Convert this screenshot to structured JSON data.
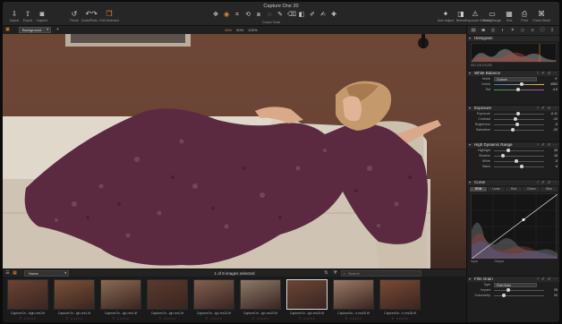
{
  "app": {
    "title": "Capture One 20"
  },
  "toolbar": {
    "left": [
      {
        "label": "Import",
        "icon": "import-icon"
      },
      {
        "label": "Export",
        "icon": "export-icon"
      },
      {
        "label": "Capture",
        "icon": "camera-icon"
      },
      {
        "label": "Reset",
        "icon": "reset-icon"
      },
      {
        "label": "Undo/Redo",
        "icon": "undo-icon"
      },
      {
        "label": "Edit Selected",
        "icon": "edit-selected-icon"
      }
    ],
    "cursor_tools_label": "Cursor Tools",
    "right": [
      {
        "label": "Auto Adjust",
        "icon": "auto-adjust-icon"
      },
      {
        "label": "Before",
        "icon": "before-icon"
      },
      {
        "label": "Exposure Warning",
        "icon": "exposure-warning-icon"
      },
      {
        "label": "Proof Margin",
        "icon": "proof-margin-icon"
      },
      {
        "label": "Grid",
        "icon": "grid-icon"
      },
      {
        "label": "Print",
        "icon": "print-icon"
      },
      {
        "label": "Cheat Sheet",
        "icon": "cheat-sheet-icon"
      }
    ]
  },
  "viewer": {
    "layer": "Background",
    "zoom_levels": [
      "25%",
      "50%",
      "100%"
    ],
    "colors": {
      "backdrop": "#6d4636",
      "sofa": "#d9d0c2",
      "dress": "#5b2a41",
      "hair": "#c49a6c"
    }
  },
  "filmstrip": {
    "album": "Home",
    "selection_status": "1 of 9 images selected",
    "search_placeholder": "Search",
    "thumbs": [
      {
        "name": "CaptureOn...high-res0.tif",
        "selected": false,
        "tone": "#6a4434"
      },
      {
        "name": "CaptureOn...igh-res1.tif",
        "selected": false,
        "tone": "#7a5238"
      },
      {
        "name": "CaptureOn...igh-res1.tif",
        "selected": false,
        "tone": "#8a6a55"
      },
      {
        "name": "CaptureOn...igh-res2.tif",
        "selected": false,
        "tone": "#5a3a2d"
      },
      {
        "name": "CaptureOn...igh-res22.tif",
        "selected": false,
        "tone": "#806050"
      },
      {
        "name": "CaptureOn...igh-res23.tif",
        "selected": false,
        "tone": "#8c7a6a"
      },
      {
        "name": "CaptureOn...igh-res24.tif",
        "selected": true,
        "tone": "#6a4636"
      },
      {
        "name": "CaptureOn...h-res26.tif",
        "selected": false,
        "tone": "#9a7a68"
      },
      {
        "name": "CaptureOn...h-res28.tif",
        "selected": false,
        "tone": "#7a4a34"
      }
    ]
  },
  "panel": {
    "histogram": {
      "title": "Histogram",
      "meta": "ISO 100  f/1/250"
    },
    "white_balance": {
      "title": "White Balance",
      "mode_label": "Mode",
      "mode_value": "Custom",
      "kelvin_label": "Kelvin",
      "kelvin_value": "4963",
      "tint_label": "Tint",
      "tint_value": "-4.6",
      "kelvin_pos": 0.55,
      "tint_pos": 0.48
    },
    "exposure": {
      "title": "Exposure",
      "rows": [
        {
          "label": "Exposure",
          "value": "-0.11",
          "pos": 0.48
        },
        {
          "label": "Contrast",
          "value": "-10",
          "pos": 0.42
        },
        {
          "label": "Brightness",
          "value": "-5",
          "pos": 0.46
        },
        {
          "label": "Saturation",
          "value": "-20",
          "pos": 0.38
        }
      ]
    },
    "hdr": {
      "title": "High Dynamic Range",
      "rows": [
        {
          "label": "Highlight",
          "value": "28",
          "pos": 0.28
        },
        {
          "label": "Shadow",
          "value": "18",
          "pos": 0.18
        },
        {
          "label": "White",
          "value": "-5",
          "pos": 0.45
        },
        {
          "label": "Black",
          "value": "6",
          "pos": 0.55
        }
      ]
    },
    "curve": {
      "title": "Curve",
      "tabs": [
        "RGB",
        "Luma",
        "Red",
        "Green",
        "Blue"
      ],
      "active_tab": "RGB",
      "input_label": "Input",
      "output_label": "Output"
    },
    "film_grain": {
      "title": "Film Grain",
      "type_label": "Type",
      "type_value": "Fine Grain",
      "impact_label": "Impact",
      "impact_value": "28",
      "impact_pos": 0.28,
      "granularity_label": "Granularity",
      "granularity_value": "20",
      "granularity_pos": 0.2
    }
  }
}
